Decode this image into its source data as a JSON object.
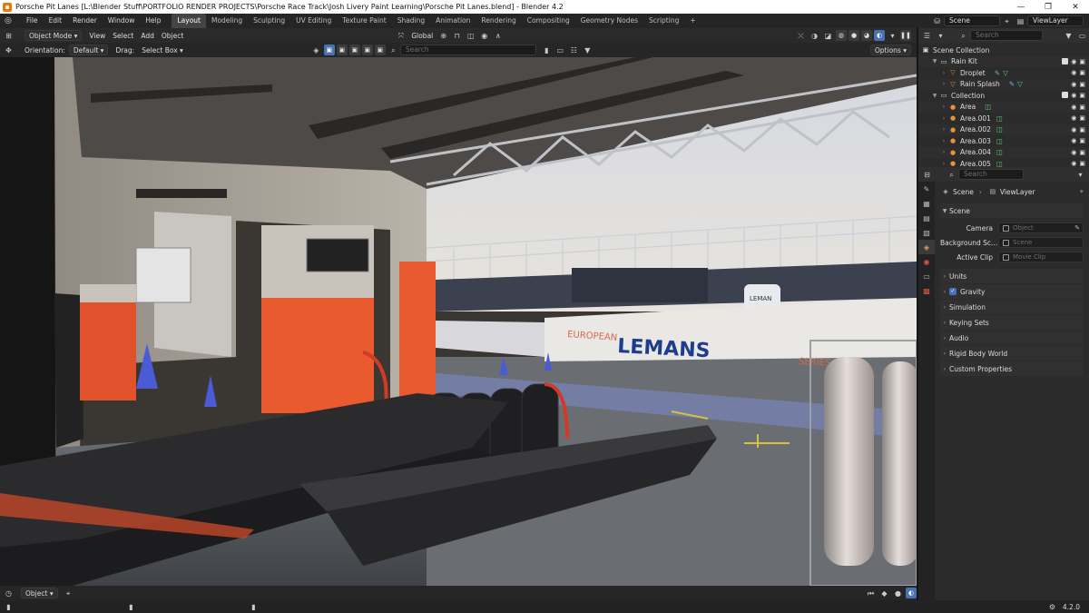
{
  "window": {
    "title": "Porsche Pit Lanes [L:\\Blender Stuff\\PORTFOLIO RENDER PROJECTS\\Porsche Race Track\\Josh Livery Paint Learning\\Porsche Pit Lanes.blend] - Blender 4.2",
    "controls": [
      "—",
      "❐",
      "✕"
    ]
  },
  "menu": {
    "items": [
      "File",
      "Edit",
      "Render",
      "Window",
      "Help"
    ],
    "workspaces": [
      "Layout",
      "Modeling",
      "Sculpting",
      "UV Editing",
      "Texture Paint",
      "Shading",
      "Animation",
      "Rendering",
      "Compositing",
      "Geometry Nodes",
      "Scripting"
    ],
    "active_workspace": "Layout",
    "add_tab": "+",
    "scene": "Scene",
    "view_layer": "ViewLayer"
  },
  "viewport_header": {
    "mode": "Object Mode",
    "menus": [
      "View",
      "Select",
      "Add",
      "Object"
    ],
    "transform": "Global",
    "search_placeholder": "Search"
  },
  "tool_settings": {
    "orientation_label": "Orientation:",
    "orientation_value": "Default",
    "drag_label": "Drag:",
    "drag_value": "Select Box",
    "options": "Options"
  },
  "outliner": {
    "search_placeholder": "Search",
    "root": "Scene Collection",
    "rows": [
      {
        "name": "Rain Kit",
        "level": 1,
        "type": "collection"
      },
      {
        "name": "Droplet",
        "level": 2,
        "type": "object"
      },
      {
        "name": "Rain Splash",
        "level": 2,
        "type": "object"
      },
      {
        "name": "Collection",
        "level": 1,
        "type": "collection"
      },
      {
        "name": "Area",
        "level": 2,
        "type": "light"
      },
      {
        "name": "Area.001",
        "level": 2,
        "type": "light"
      },
      {
        "name": "Area.002",
        "level": 2,
        "type": "light"
      },
      {
        "name": "Area.003",
        "level": 2,
        "type": "light"
      },
      {
        "name": "Area.004",
        "level": 2,
        "type": "light"
      },
      {
        "name": "Area.005",
        "level": 2,
        "type": "light"
      }
    ]
  },
  "properties": {
    "search_placeholder": "Search",
    "breadcrumb_scene": "Scene",
    "breadcrumb_layer": "ViewLayer",
    "scene_panel": "Scene",
    "camera_label": "Camera",
    "camera_value": "Object",
    "background_label": "Background Sc...",
    "background_value": "Scene",
    "active_clip_label": "Active Clip",
    "active_clip_value": "Movie Clip",
    "panels": [
      "Units",
      "Gravity",
      "Simulation",
      "Keying Sets",
      "Audio",
      "Rigid Body World",
      "Custom Properties"
    ]
  },
  "footer": {
    "mode": "Object",
    "version": "4.2.0"
  },
  "scene_text": {
    "sign_top": "EUROPEAN",
    "sign_bottom": "SERIES",
    "sign_main": "LEMANS",
    "board": "LEMAN"
  },
  "colors": {
    "accent": "#4772b3",
    "orange": "#e87d0d",
    "active_tab": "#444444"
  }
}
